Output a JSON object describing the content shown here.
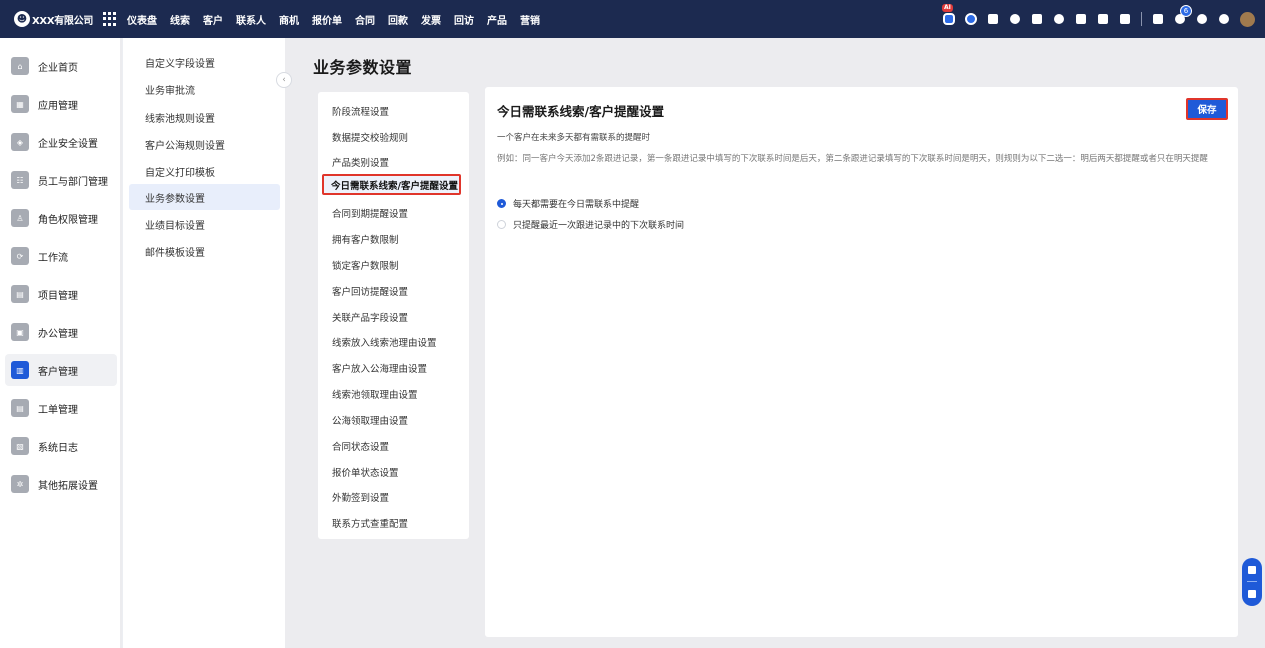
{
  "brand": {
    "logo_glyph": "☻",
    "name": "XXX有限公司"
  },
  "nav": [
    "仪表盘",
    "线索",
    "客户",
    "联系人",
    "商机",
    "报价单",
    "合同",
    "回款",
    "发票",
    "回访",
    "产品",
    "营销"
  ],
  "top_badges": {
    "ai": "AI",
    "notifications": "6"
  },
  "sidebar": [
    {
      "label": "企业首页",
      "icon": "home-icon",
      "glyph": "⌂"
    },
    {
      "label": "应用管理",
      "icon": "apps-icon",
      "glyph": "▦"
    },
    {
      "label": "企业安全设置",
      "icon": "shield-icon",
      "glyph": "◈"
    },
    {
      "label": "员工与部门管理",
      "icon": "users-icon",
      "glyph": "☷"
    },
    {
      "label": "角色权限管理",
      "icon": "user-icon",
      "glyph": "♙"
    },
    {
      "label": "工作流",
      "icon": "workflow-icon",
      "glyph": "⟳"
    },
    {
      "label": "项目管理",
      "icon": "project-icon",
      "glyph": "▤"
    },
    {
      "label": "办公管理",
      "icon": "office-icon",
      "glyph": "▣"
    },
    {
      "label": "客户管理",
      "icon": "customer-icon",
      "glyph": "▥"
    },
    {
      "label": "工单管理",
      "icon": "ticket-icon",
      "glyph": "▤"
    },
    {
      "label": "系统日志",
      "icon": "log-icon",
      "glyph": "▧"
    },
    {
      "label": "其他拓展设置",
      "icon": "extension-icon",
      "glyph": "✲"
    }
  ],
  "submenu": [
    "自定义字段设置",
    "业务审批流",
    "线索池规则设置",
    "客户公海规则设置",
    "自定义打印模板",
    "业务参数设置",
    "业绩目标设置",
    "邮件模板设置"
  ],
  "page_title": "业务参数设置",
  "settings_list": [
    "阶段流程设置",
    "数据提交校验规则",
    "产品类别设置",
    "今日需联系线索/客户提醒设置",
    "合同到期提醒设置",
    "拥有客户数限制",
    "锁定客户数限制",
    "客户回访提醒设置",
    "关联产品字段设置",
    "线索放入线索池理由设置",
    "客户放入公海理由设置",
    "线索池领取理由设置",
    "公海领取理由设置",
    "合同状态设置",
    "报价单状态设置",
    "外勤签到设置",
    "联系方式查重配置"
  ],
  "main": {
    "title": "今日需联系线索/客户提醒设置",
    "save_label": "保存",
    "description": "一个客户在未来多天都有需联系的提醒时",
    "example": "例如：同一客户今天添加2条跟进记录，第一条跟进记录中填写的下次联系时间是后天，第二条跟进记录填写的下次联系时间是明天，则规则为以下二选一：明后两天都提醒或者只在明天提醒",
    "options": [
      {
        "label": "每天都需要在今日需联系中提醒",
        "checked": true
      },
      {
        "label": "只提醒最近一次跟进记录中的下次联系时间",
        "checked": false
      }
    ]
  },
  "colors": {
    "topbar": "#1c2a50",
    "primary": "#1f5ad8",
    "highlight_border": "#e0352b"
  }
}
